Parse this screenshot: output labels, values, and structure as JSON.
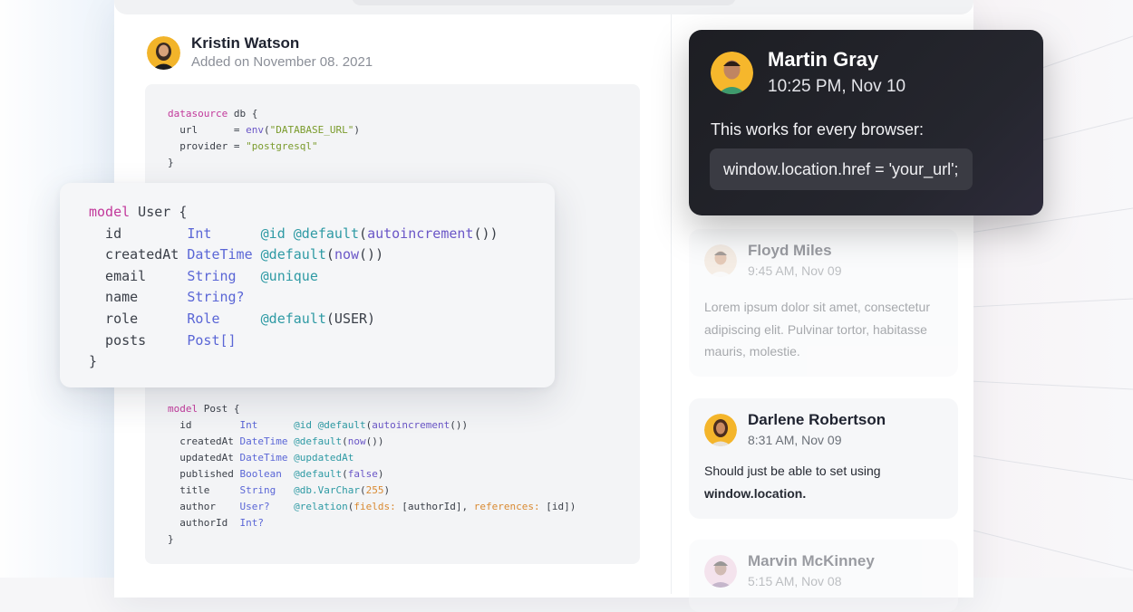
{
  "post": {
    "author_name": "Kristin Watson",
    "added_date": "Added on November 08. 2021"
  },
  "code_top": [
    [
      {
        "t": "datasource",
        "c": "kw"
      },
      {
        "t": " db {",
        "c": "plain"
      }
    ],
    [
      {
        "t": "  url      ",
        "c": "plain"
      },
      {
        "t": "= ",
        "c": "plain"
      },
      {
        "t": "env",
        "c": "fn"
      },
      {
        "t": "(",
        "c": "plain"
      },
      {
        "t": "\"DATABASE_URL\"",
        "c": "str"
      },
      {
        "t": ")",
        "c": "plain"
      }
    ],
    [
      {
        "t": "  provider ",
        "c": "plain"
      },
      {
        "t": "= ",
        "c": "plain"
      },
      {
        "t": "\"postgresql\"",
        "c": "str"
      }
    ],
    [
      {
        "t": "}",
        "c": "plain"
      }
    ]
  ],
  "code_user": [
    [
      {
        "t": "model",
        "c": "kw"
      },
      {
        "t": " User {",
        "c": "plain"
      }
    ],
    [
      {
        "t": "  id        ",
        "c": "plain"
      },
      {
        "t": "Int      ",
        "c": "ty"
      },
      {
        "t": "@id @default",
        "c": "at"
      },
      {
        "t": "(",
        "c": "plain"
      },
      {
        "t": "autoincrement",
        "c": "fn"
      },
      {
        "t": "())",
        "c": "plain"
      }
    ],
    [
      {
        "t": "  createdAt ",
        "c": "plain"
      },
      {
        "t": "DateTime ",
        "c": "ty"
      },
      {
        "t": "@default",
        "c": "at"
      },
      {
        "t": "(",
        "c": "plain"
      },
      {
        "t": "now",
        "c": "fn"
      },
      {
        "t": "())",
        "c": "plain"
      }
    ],
    [
      {
        "t": "  email     ",
        "c": "plain"
      },
      {
        "t": "String   ",
        "c": "ty"
      },
      {
        "t": "@unique",
        "c": "at"
      }
    ],
    [
      {
        "t": "  name      ",
        "c": "plain"
      },
      {
        "t": "String?",
        "c": "ty"
      }
    ],
    [
      {
        "t": "  role      ",
        "c": "plain"
      },
      {
        "t": "Role     ",
        "c": "ty"
      },
      {
        "t": "@default",
        "c": "at"
      },
      {
        "t": "(USER)",
        "c": "plain"
      }
    ],
    [
      {
        "t": "  posts     ",
        "c": "plain"
      },
      {
        "t": "Post[]",
        "c": "ty"
      }
    ],
    [
      {
        "t": "}",
        "c": "plain"
      }
    ]
  ],
  "code_post": [
    [
      {
        "t": "model",
        "c": "kw"
      },
      {
        "t": " Post {",
        "c": "plain"
      }
    ],
    [
      {
        "t": "  id        ",
        "c": "plain"
      },
      {
        "t": "Int      ",
        "c": "ty"
      },
      {
        "t": "@id @default",
        "c": "at"
      },
      {
        "t": "(",
        "c": "plain"
      },
      {
        "t": "autoincrement",
        "c": "fn"
      },
      {
        "t": "())",
        "c": "plain"
      }
    ],
    [
      {
        "t": "  createdAt ",
        "c": "plain"
      },
      {
        "t": "DateTime ",
        "c": "ty"
      },
      {
        "t": "@default",
        "c": "at"
      },
      {
        "t": "(",
        "c": "plain"
      },
      {
        "t": "now",
        "c": "fn"
      },
      {
        "t": "())",
        "c": "plain"
      }
    ],
    [
      {
        "t": "  updatedAt ",
        "c": "plain"
      },
      {
        "t": "DateTime ",
        "c": "ty"
      },
      {
        "t": "@updatedAt",
        "c": "at"
      }
    ],
    [
      {
        "t": "  published ",
        "c": "plain"
      },
      {
        "t": "Boolean  ",
        "c": "ty"
      },
      {
        "t": "@default",
        "c": "at"
      },
      {
        "t": "(",
        "c": "plain"
      },
      {
        "t": "false",
        "c": "fn"
      },
      {
        "t": ")",
        "c": "plain"
      }
    ],
    [
      {
        "t": "  title     ",
        "c": "plain"
      },
      {
        "t": "String   ",
        "c": "ty"
      },
      {
        "t": "@db.VarChar",
        "c": "at"
      },
      {
        "t": "(",
        "c": "plain"
      },
      {
        "t": "255",
        "c": "arg"
      },
      {
        "t": ")",
        "c": "plain"
      }
    ],
    [
      {
        "t": "  author    ",
        "c": "plain"
      },
      {
        "t": "User?    ",
        "c": "ty"
      },
      {
        "t": "@relation",
        "c": "at"
      },
      {
        "t": "(",
        "c": "plain"
      },
      {
        "t": "fields:",
        "c": "arg"
      },
      {
        "t": " [authorId], ",
        "c": "plain"
      },
      {
        "t": "references:",
        "c": "arg"
      },
      {
        "t": " [id])",
        "c": "plain"
      }
    ],
    [
      {
        "t": "  authorId  ",
        "c": "plain"
      },
      {
        "t": "Int?",
        "c": "ty"
      }
    ],
    [
      {
        "t": "}",
        "c": "plain"
      }
    ]
  ],
  "comments": {
    "featured": {
      "name": "Martin Gray",
      "time": "10:25 PM, Nov 10",
      "message": "This works for every browser:",
      "code": "window.location.href = 'your_url';"
    },
    "floyd": {
      "name": "Floyd Miles",
      "time": "9:45 AM, Nov 09",
      "body": "Lorem ipsum dolor sit amet, consectetur adipiscing elit. Pulvinar tortor, habitasse mauris, molestie."
    },
    "darlene": {
      "name": "Darlene Robertson",
      "time": "8:31 AM, Nov 09",
      "body_prefix": "Should just be able to set using ",
      "body_bold": "window.location."
    },
    "marvin": {
      "name": "Marvin McKinney",
      "time": "5:15 AM, Nov 08"
    }
  },
  "colors": {
    "keyword": "#c2399b",
    "type": "#5a66d6",
    "attribute": "#2e9aa4",
    "function": "#6a56c7",
    "string": "#7a9b2c",
    "argument": "#d98a32",
    "dark_card_bg": "#1d1e23"
  }
}
